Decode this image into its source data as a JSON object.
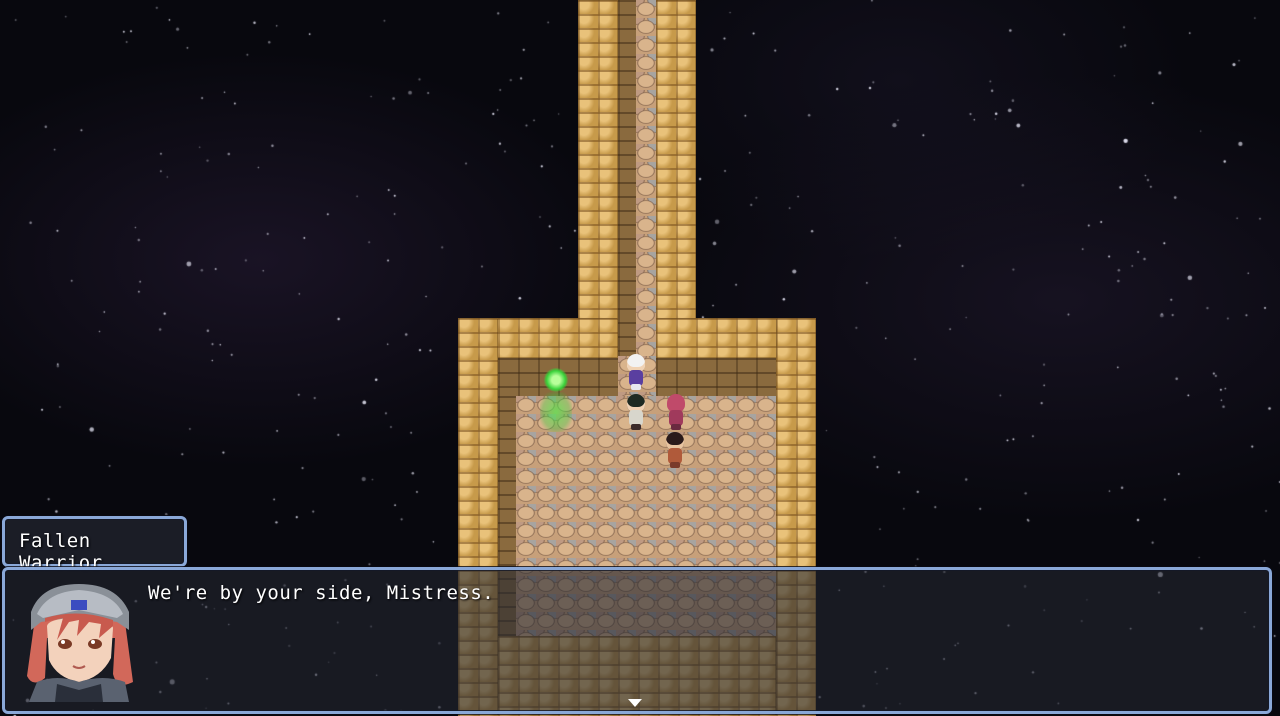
{
  "dialogue": {
    "speaker_name": "Fallen Warrior",
    "message": "We're by your side, Mistress.",
    "portrait_icon": "fallen-warrior-portrait",
    "continue_icon": "continue-arrow-icon"
  },
  "map": {
    "background": "starfield",
    "characters": [
      "white-haired-leader",
      "dark-haired-follower",
      "pink-haired-follower",
      "brown-haired-follower"
    ],
    "event_marker": "green-glow-event"
  },
  "colors": {
    "window_border": "#8aa8d8",
    "window_fill": "#23263099",
    "brick": "#c79a4a",
    "event_glow": "#39d23a"
  }
}
